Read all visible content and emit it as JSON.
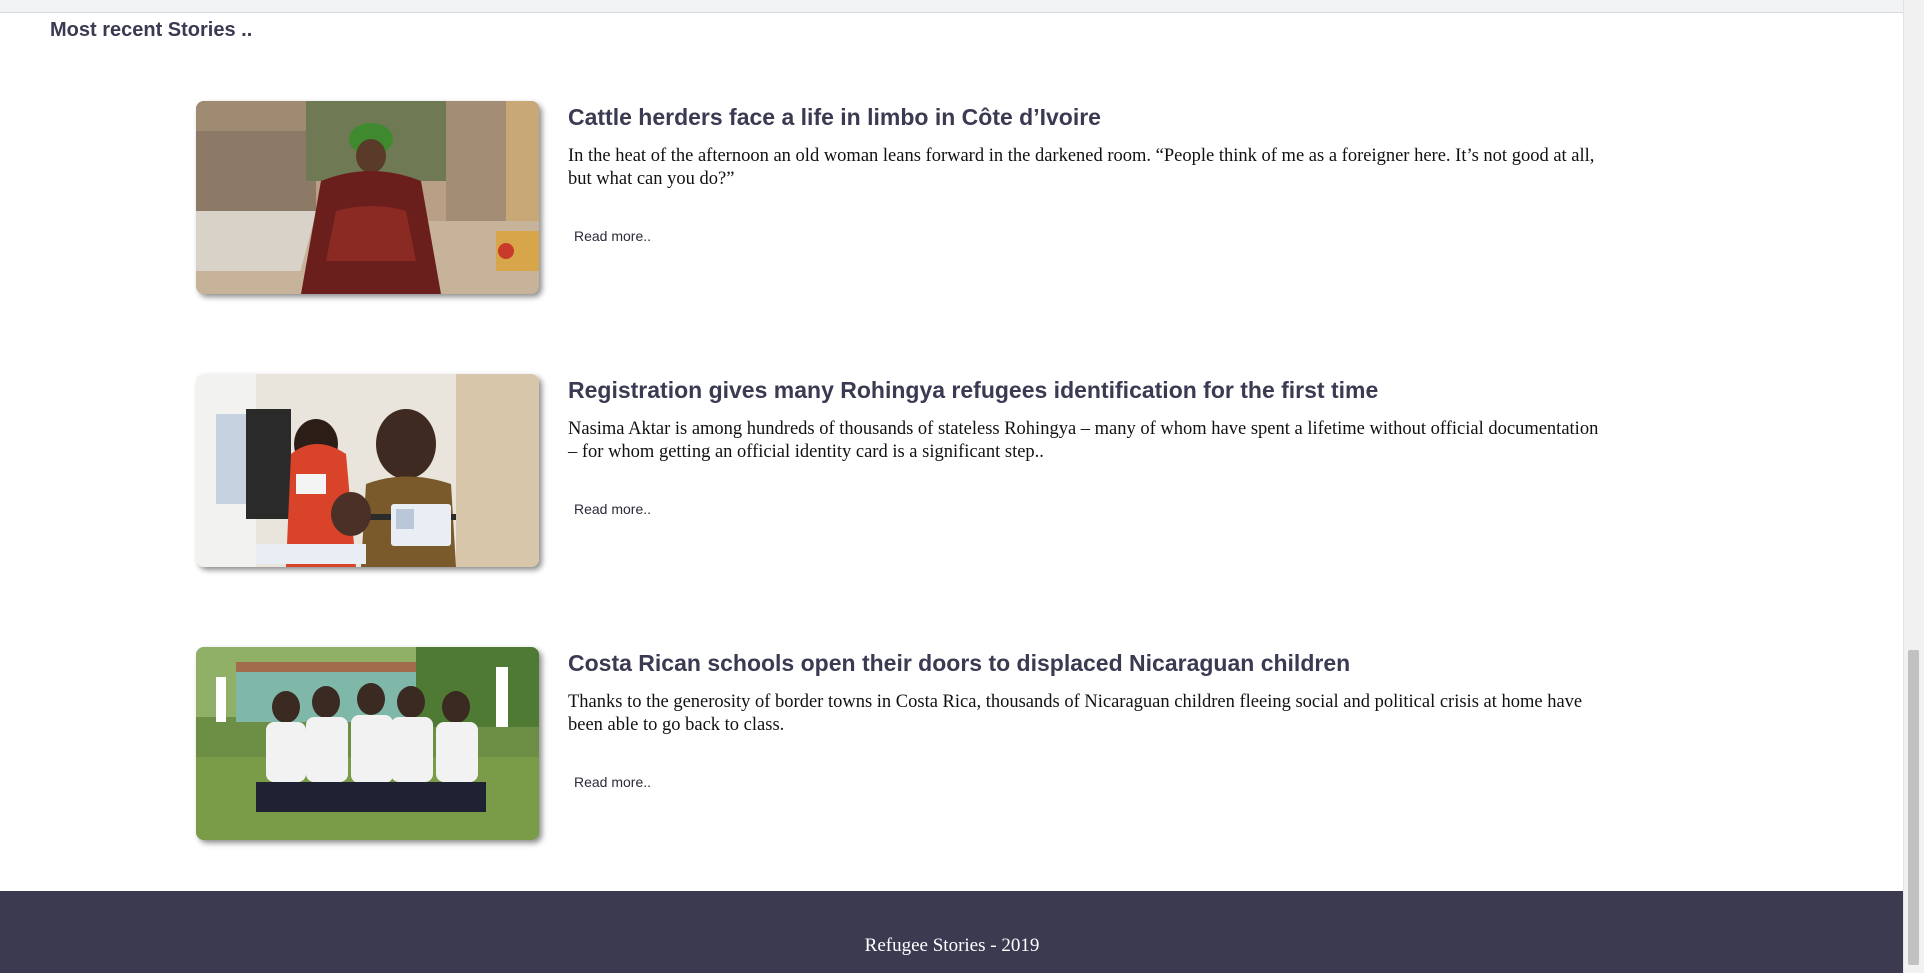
{
  "section_title": "Most recent Stories ..",
  "stories": [
    {
      "title": "Cattle herders face a life in limbo in Côte d’Ivoire",
      "excerpt": "In the heat of the afternoon an old woman leans forward in the darkened room. “People think of me as a foreigner here. It’s not good at all, but what can you do?”",
      "read_more": "Read more..",
      "image_alt": "Elderly woman in a green headscarf seated outside a mud house"
    },
    {
      "title": "Registration gives many Rohingya refugees identification for the first time",
      "excerpt": "Nasima Aktar is among hundreds of thousands of stateless Rohingya – many of whom have spent a lifetime without official documentation – for whom getting an official identity card is a significant step..",
      "read_more": "Read more..",
      "image_alt": "Rohingya woman and children holding identity cards"
    },
    {
      "title": "Costa Rican schools open their doors to displaced Nicaraguan children",
      "excerpt": "Thanks to the generosity of border towns in Costa Rica, thousands of Nicaraguan children fleeing social and political crisis at home have been able to go back to class.",
      "read_more": "Read more..",
      "image_alt": "Schoolgirls sitting on grass with arms around each other"
    }
  ],
  "footer": {
    "text": "Refugee Stories - 2019"
  }
}
